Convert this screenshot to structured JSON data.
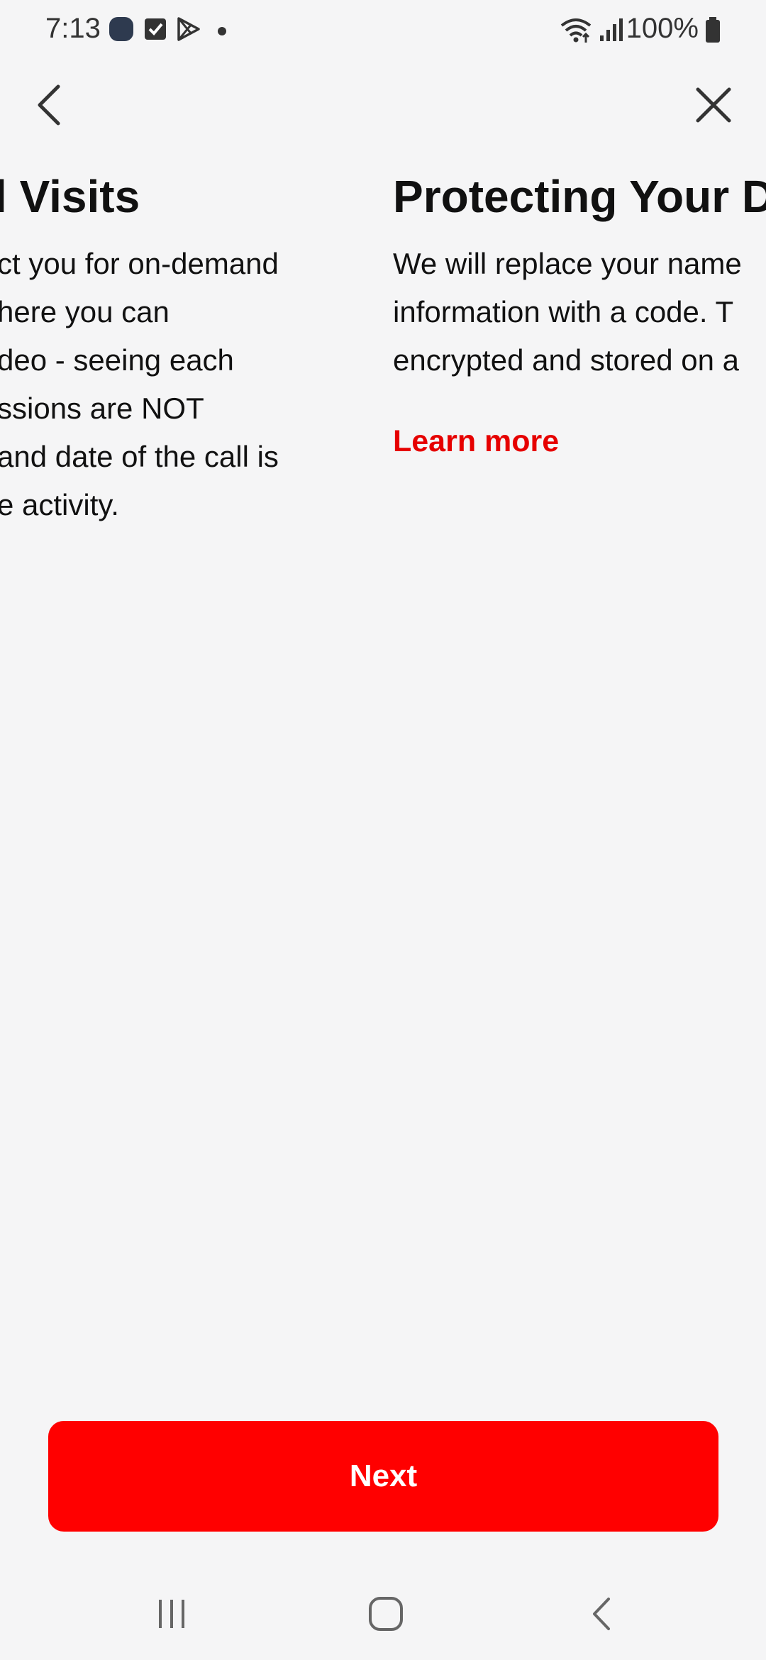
{
  "status_bar": {
    "time": "7:13",
    "battery": "100%",
    "icons": [
      "app-icon",
      "checkbox-icon",
      "play-store-icon",
      "dot-icon",
      "wifi-icon",
      "signal-icon",
      "battery-icon"
    ]
  },
  "header": {
    "back_icon": "chevron-left-icon",
    "close_icon": "close-icon"
  },
  "slides": [
    {
      "title": "l Visits",
      "lines": [
        "ct you for on-demand",
        "here you can",
        "deo - seeing each",
        "ssions are NOT",
        "and date of the call is",
        "e activity."
      ]
    },
    {
      "title": "Protecting Your D",
      "lines": [
        "We will replace your name",
        "information with a code. T",
        "encrypted and stored on a"
      ],
      "link": "Learn more"
    }
  ],
  "footer": {
    "next_label": "Next"
  },
  "colors": {
    "accent": "#ff0000",
    "link": "#e60000",
    "background": "#f5f5f6"
  },
  "system_nav": {
    "recents": "recents-icon",
    "home": "home-icon",
    "back": "back-icon"
  }
}
